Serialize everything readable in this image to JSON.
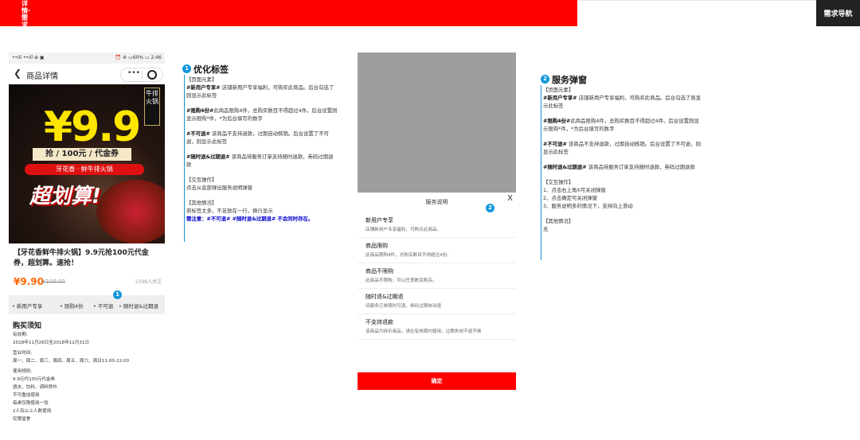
{
  "header": {
    "title": "详情·需求",
    "nav_button": "需求导航"
  },
  "phone": {
    "status_left": "••ıll ••ıll ⊕ ▣",
    "status_right": "⏰ ✲ ▭60% ▭ 2:46",
    "nav_title": "商品详情",
    "poster": {
      "tag": "牛排火锅",
      "price": "¥9.9",
      "coupon": "抢 / 100元 / 代金券",
      "brand_line": "牙花香 · 鲜牛排火锅",
      "slogan": "超划算!"
    },
    "product_title": "【牙花香鲜牛排火锅】9.9元抢100元代金券，超划算。速抢！",
    "price": "¥9.90",
    "original_price": "¥100.00",
    "followers": "2398人关注",
    "tags": [
      "• 新用户专享",
      "• 限购4份",
      "• 不可退",
      "• 随时退&过期退"
    ],
    "tags_badge": "1",
    "buy_title": "购买须知",
    "buy_lines": [
      "有效期:",
      "2018年11月26日至2018年12月31日",
      "营业时间:",
      "周一、周二、周三、周四、周五、周六、周日11:00-22:00",
      "使用规则:",
      "9.9元代100元代金券",
      "酒水、饮料、调料除外",
      "不可叠加使用",
      "每桌仅限使用一张",
      "2人及以上人数使用",
      "仅限堂食"
    ]
  },
  "section1": {
    "badge": "1",
    "title": "优化标签",
    "page_elements_label": "【页面元素】",
    "p1_key": "#新用户专享#",
    "p1_text": "店铺新用户专享福利，可购买此商品。后台勾选了则显示此标签",
    "p2_key": "#限购4份#",
    "p2_text": "此商品限购4件，总购买数目不得超过4件。后台设置则显示限购*件，*为后台填写的数字",
    "p3_key": "#不可退#",
    "p3_text": "该商品不支持退款，过期自动核销。后台设置了不可退，则显示此标签",
    "p4_key": "#随时退&过期退#",
    "p4_text": "该商品待服务订单支持随时退款，券码过期退款",
    "interaction_label": "【交互操作】",
    "interaction_text": "点击从底部弹出服务说明弹窗",
    "other_label": "【其他情况】",
    "other_text": "若标签太多，不足放在一行，换行显示",
    "note": "需注意：#不可退#  #随时退&过期退#  不会同时存在。"
  },
  "modal": {
    "title": "服务说明",
    "close": "X",
    "badge": "2",
    "items": [
      {
        "title": "新用户专享",
        "desc": "店铺新用户专享福利，可购买此商品。"
      },
      {
        "title": "商品限购",
        "desc": "此商品限购4件，总购买数目不得超过4份。"
      },
      {
        "title": "商品不限购",
        "desc": "此商品不限购，可以任意数目购买。"
      },
      {
        "title": "随时退&过期退",
        "desc": "待服务订单随时可退，券码过期自动退"
      },
      {
        "title": "不支持退款",
        "desc": "该商品为特价商品，请在有效期内使用，过期失效不退不换"
      }
    ],
    "confirm": "确定"
  },
  "section2": {
    "badge": "2",
    "title": "服务弹窗",
    "page_elements_label": "【页面元素】",
    "p1_key": "#新用户专享#",
    "p1_text": "店铺新用户专享福利，可购买此商品。后台勾选了则显示此标签",
    "p2_key": "#限购4份#",
    "p2_text": "此商品限购4件，总购买数目不得超过4件。后台设置则显示限购*件，*为后台填写的数字",
    "p3_key": "#不可退#",
    "p3_text": "该商品不支持退款，过期自动核销。后台设置了不可退，则显示此标签",
    "p4_key": "#随时退&过期退#",
    "p4_text": "该商品待服务订单支持随时退款，券码过期退款",
    "interaction_label": "【交互操作】",
    "interaction_lines": [
      "1、点击右上角X可关闭弹窗",
      "2、点击确定可关闭弹窗",
      "3、服务说明多的情况下，支持向上滑动"
    ],
    "other_label": "【其他情况】",
    "other_text": "无"
  },
  "colors": {
    "brand_red": "#ff0000",
    "badge_blue": "#1296db",
    "price_orange": "#ff6600",
    "note_blue": "#0000cc"
  }
}
